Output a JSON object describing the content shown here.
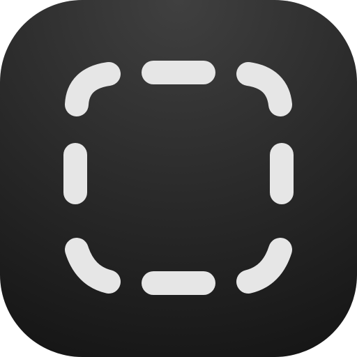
{
  "icon": {
    "name": "screenshot-selection-icon",
    "background_top": "#404040",
    "background_bottom": "#161616",
    "dash_color": "#e6e6e6"
  }
}
